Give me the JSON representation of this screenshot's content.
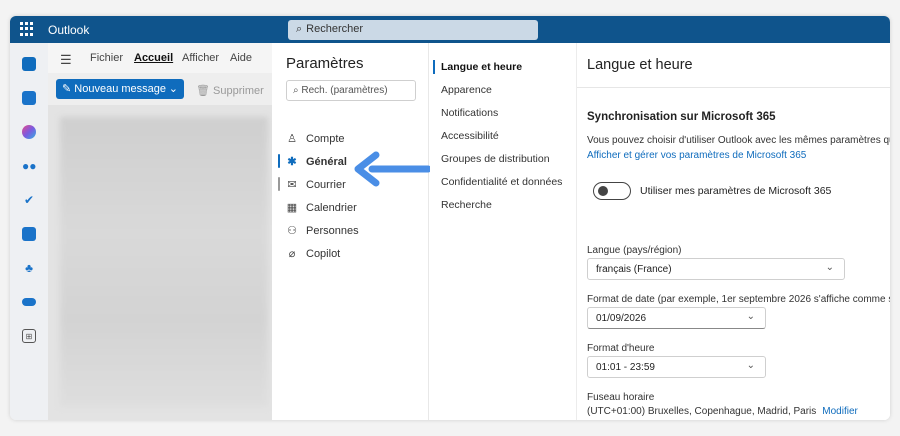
{
  "app": {
    "name": "Outlook"
  },
  "search": {
    "placeholder": "Rechercher"
  },
  "ribbon": {
    "tabs": [
      "Fichier",
      "Accueil",
      "Afficher",
      "Aide"
    ],
    "active_tab": "Accueil"
  },
  "toolbar": {
    "new_message": "Nouveau message",
    "delete": "Supprimer"
  },
  "settings": {
    "title": "Paramètres",
    "search_placeholder": "Rech. (paramètres)",
    "categories": [
      {
        "label": "Compte",
        "icon": "person-icon"
      },
      {
        "label": "Général",
        "icon": "gear-icon",
        "selected": true
      },
      {
        "label": "Courrier",
        "icon": "mail-icon"
      },
      {
        "label": "Calendrier",
        "icon": "calendar-icon"
      },
      {
        "label": "Personnes",
        "icon": "people-icon"
      },
      {
        "label": "Copilot",
        "icon": "copilot-icon"
      }
    ],
    "subcategories": [
      "Langue et heure",
      "Apparence",
      "Notifications",
      "Accessibilité",
      "Groupes de distribution",
      "Confidentialité et données",
      "Recherche"
    ],
    "selected_subcategory": "Langue et heure"
  },
  "content": {
    "title": "Langue et heure",
    "sync_title": "Synchronisation sur Microsoft 365",
    "sync_desc": "Vous pouvez choisir d'utiliser Outlook avec les mêmes paramètres qu",
    "sync_link": "Afficher et gérer vos paramètres de Microsoft 365",
    "toggle_label": "Utiliser mes paramètres de Microsoft 365",
    "toggle_on": false,
    "language_label": "Langue (pays/région)",
    "language_value": "français (France)",
    "date_format_label": "Format de date (par exemple, 1er septembre 2026 s'affiche comme s",
    "date_format_value": "01/09/2026",
    "time_format_label": "Format d'heure",
    "time_format_value": "01:01 - 23:59",
    "timezone_label": "Fuseau horaire",
    "timezone_value": "(UTC+01:00) Bruxelles, Copenhague, Madrid, Paris",
    "timezone_action": "Modifier"
  },
  "colors": {
    "topbar": "#0f548c",
    "accent": "#0f6cbd",
    "arrow": "#4a8ee6"
  }
}
